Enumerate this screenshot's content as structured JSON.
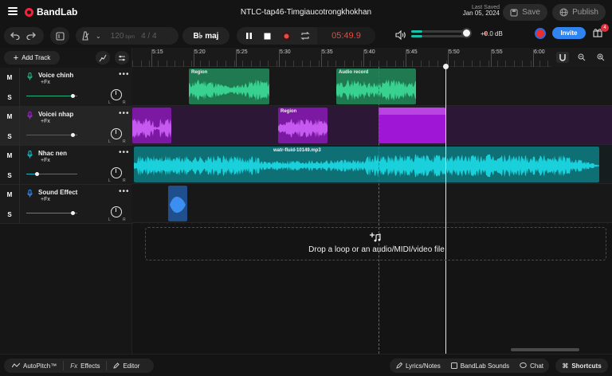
{
  "app": {
    "brand": "BandLab",
    "project_title": "NTLC-tap46-Timgiaucotrongkhokhan"
  },
  "save_status": {
    "label": "Last Saved",
    "date": "Jan 05, 2024"
  },
  "header_buttons": {
    "save": "Save",
    "publish": "Publish"
  },
  "toolbar": {
    "tempo": "120",
    "tempo_unit": "bpm",
    "time_signature": "4 / 4",
    "key": "B♭ maj",
    "time": "05:49.9",
    "volume_db": "+0.0 dB",
    "volume_level": 0.65,
    "invite": "Invite",
    "notifications_count": "4"
  },
  "track_header": {
    "add_track": "Add Track"
  },
  "tracks": [
    {
      "name": "Voice chinh",
      "fx": "+Fx",
      "mute": "M",
      "solo": "S",
      "pan_l": "L",
      "pan_r": "R",
      "color": "#22b07a",
      "volume": 0.9
    },
    {
      "name": "Voicei nhap",
      "fx": "+Fx",
      "mute": "M",
      "solo": "S",
      "pan_l": "L",
      "pan_r": "R",
      "color": "#a31fd1",
      "volume": 0.9
    },
    {
      "name": "Nhac nen",
      "fx": "+Fx",
      "mute": "M",
      "solo": "S",
      "pan_l": "L",
      "pan_r": "R",
      "color": "#11b7c2",
      "volume": 0.2
    },
    {
      "name": "Sound Effect",
      "fx": "+Fx",
      "mute": "M",
      "solo": "S",
      "pan_l": "L",
      "pan_r": "R",
      "color": "#2f84f0",
      "volume": 0.9
    }
  ],
  "ruler": {
    "labels": [
      "5:15",
      "5:20",
      "5:25",
      "5:30",
      "5:35",
      "5:40",
      "5:45",
      "5:50",
      "5:55",
      "6:00"
    ]
  },
  "regions": {
    "voice_region": "Region",
    "audio_record": "Audio record",
    "purple_region": "Region",
    "music_file": "watr-fluid-10149.mp3"
  },
  "drop_zone": {
    "text": "Drop a loop or an audio/MIDI/video file"
  },
  "bottom_bar": {
    "autopitch": "AutoPitch™",
    "effects": "Effects",
    "editor": "Editor",
    "lyrics": "Lyrics/Notes",
    "sounds": "BandLab Sounds",
    "chat": "Chat",
    "shortcuts": "Shortcuts"
  }
}
